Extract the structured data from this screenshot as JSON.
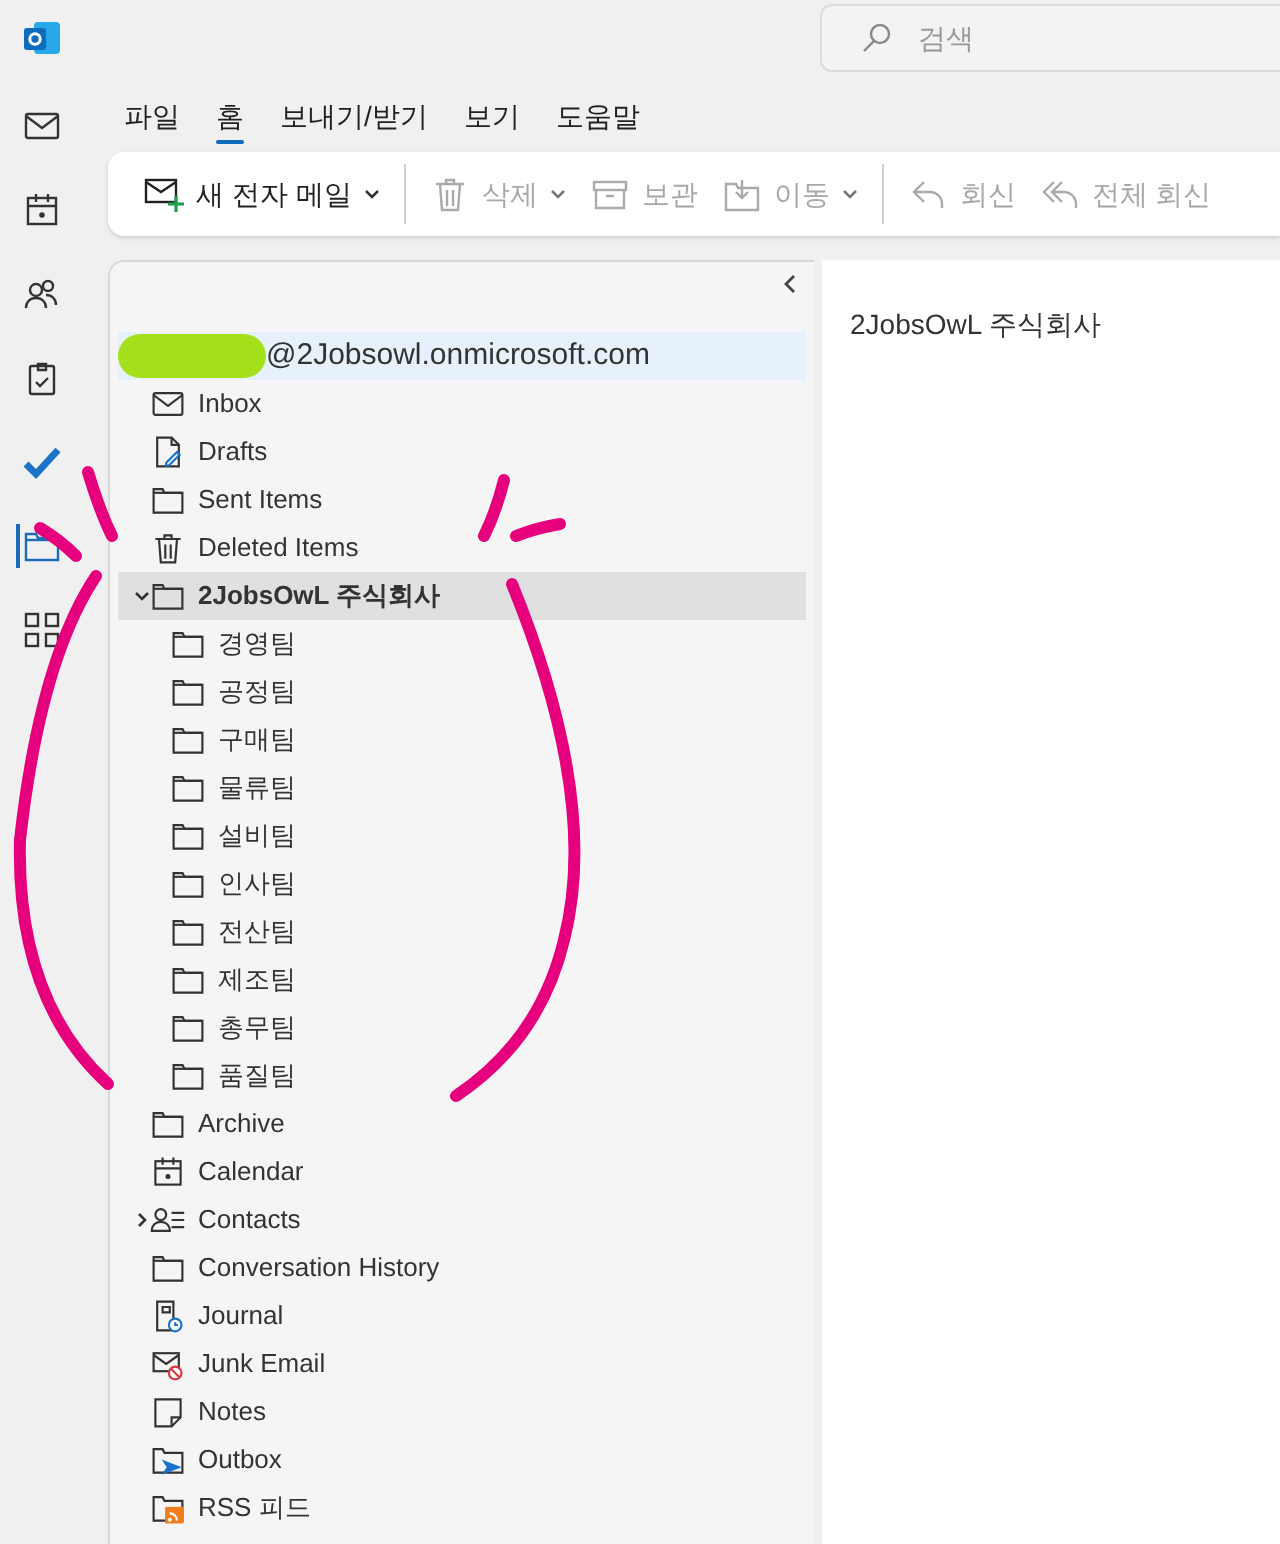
{
  "search": {
    "placeholder": "검색"
  },
  "nav_rail": [
    {
      "kind": "mail",
      "selected": false
    },
    {
      "kind": "calendar",
      "selected": false
    },
    {
      "kind": "people",
      "selected": false
    },
    {
      "kind": "tasks",
      "selected": false
    },
    {
      "kind": "todo",
      "selected": false
    },
    {
      "kind": "folders",
      "selected": true
    },
    {
      "kind": "apps",
      "selected": false
    }
  ],
  "ribbon_tabs": [
    {
      "label": "파일",
      "selected": false
    },
    {
      "label": "홈",
      "selected": true
    },
    {
      "label": "보내기/받기",
      "selected": false
    },
    {
      "label": "보기",
      "selected": false
    },
    {
      "label": "도움말",
      "selected": false
    }
  ],
  "toolbar_groups": [
    {
      "buttons": [
        {
          "kind": "new-mail",
          "label": "새 전자 메일",
          "dropdown": true,
          "disabled": false
        }
      ]
    },
    {
      "buttons": [
        {
          "kind": "trash",
          "label": "삭제",
          "dropdown": true,
          "disabled": true
        },
        {
          "kind": "archive",
          "label": "보관",
          "dropdown": false,
          "disabled": true
        },
        {
          "kind": "move",
          "label": "이동",
          "dropdown": true,
          "disabled": true
        }
      ]
    },
    {
      "buttons": [
        {
          "kind": "reply",
          "label": "회신",
          "dropdown": false,
          "disabled": true
        },
        {
          "kind": "reply-all",
          "label": "전체 회신",
          "dropdown": false,
          "disabled": true
        }
      ]
    }
  ],
  "folder_pane": {
    "account": "@2Jobsowl.onmicrosoft.com",
    "folders": [
      {
        "kind": "mail",
        "label": "Inbox",
        "selected": false
      },
      {
        "kind": "drafts",
        "label": "Drafts",
        "selected": false
      },
      {
        "kind": "folder",
        "label": "Sent Items",
        "selected": false
      },
      {
        "kind": "trash",
        "label": "Deleted Items",
        "selected": false
      },
      {
        "kind": "folder",
        "label": "2JobsOwL 주식회사",
        "selected": true,
        "expanded": true,
        "children": [
          {
            "kind": "folder",
            "label": "경영팀",
            "selected": false
          },
          {
            "kind": "folder",
            "label": "공정팀",
            "selected": false
          },
          {
            "kind": "folder",
            "label": "구매팀",
            "selected": false
          },
          {
            "kind": "folder",
            "label": "물류팀",
            "selected": false
          },
          {
            "kind": "folder",
            "label": "설비팀",
            "selected": false
          },
          {
            "kind": "folder",
            "label": "인사팀",
            "selected": false
          },
          {
            "kind": "folder",
            "label": "전산팀",
            "selected": false
          },
          {
            "kind": "folder",
            "label": "제조팀",
            "selected": false
          },
          {
            "kind": "folder",
            "label": "총무팀",
            "selected": false
          },
          {
            "kind": "folder",
            "label": "품질팀",
            "selected": false
          }
        ]
      },
      {
        "kind": "folder",
        "label": "Archive",
        "selected": false
      },
      {
        "kind": "calendar",
        "label": "Calendar",
        "selected": false
      },
      {
        "kind": "contacts",
        "label": "Contacts",
        "selected": false,
        "expanded": false
      },
      {
        "kind": "folder",
        "label": "Conversation History",
        "selected": false
      },
      {
        "kind": "journal",
        "label": "Journal",
        "selected": false
      },
      {
        "kind": "junk",
        "label": "Junk Email",
        "selected": false
      },
      {
        "kind": "notes",
        "label": "Notes",
        "selected": false
      },
      {
        "kind": "outbox",
        "label": "Outbox",
        "selected": false
      },
      {
        "kind": "rss",
        "label": "RSS 피드",
        "selected": false
      }
    ]
  },
  "content": {
    "title": "2JobsOwL 주식회사"
  }
}
